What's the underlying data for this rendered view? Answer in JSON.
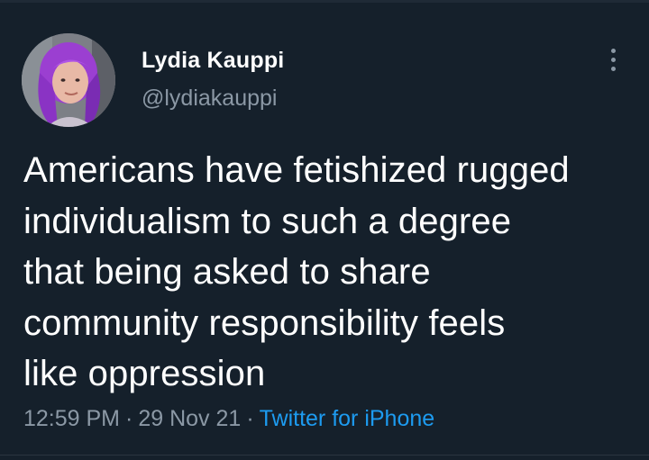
{
  "author": {
    "display_name": "Lydia Kauppi",
    "handle": "@lydiakauppi",
    "avatar_icon": "profile-photo"
  },
  "tweet": {
    "lines": [
      "Americans have fetishized rugged",
      "individualism to such a degree",
      "that being asked to share",
      "community responsibility feels",
      "like oppression"
    ]
  },
  "meta": {
    "time": "12:59 PM",
    "date": "29 Nov 21",
    "separator": "·",
    "source": "Twitter for iPhone"
  },
  "colors": {
    "background": "#15202b",
    "primary_text": "#ffffff",
    "secondary_text": "#8b98a5",
    "accent": "#1d9bf0"
  },
  "icons": {
    "more": "more-vertical-icon"
  }
}
